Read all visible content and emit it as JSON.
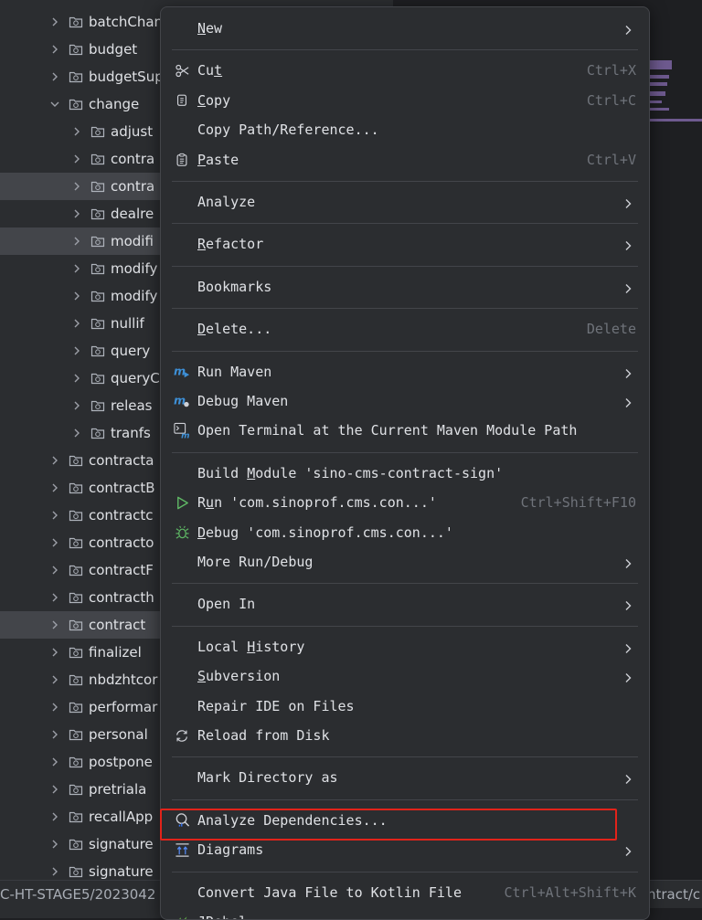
{
  "tree": {
    "items": [
      {
        "label": "batchChan",
        "level": 0,
        "expanded": false,
        "selected": false
      },
      {
        "label": "budget",
        "level": 0,
        "expanded": false,
        "selected": false
      },
      {
        "label": "budgetSup",
        "level": 0,
        "expanded": false,
        "selected": false
      },
      {
        "label": "change",
        "level": 0,
        "expanded": true,
        "selected": false
      },
      {
        "label": "adjust",
        "level": 1,
        "expanded": false,
        "selected": false
      },
      {
        "label": "contra",
        "level": 1,
        "expanded": false,
        "selected": false
      },
      {
        "label": "contra",
        "level": 1,
        "expanded": false,
        "selected": true
      },
      {
        "label": "dealre",
        "level": 1,
        "expanded": false,
        "selected": false
      },
      {
        "label": "modifi",
        "level": 1,
        "expanded": false,
        "selected": true
      },
      {
        "label": "modify",
        "level": 1,
        "expanded": false,
        "selected": false
      },
      {
        "label": "modify",
        "level": 1,
        "expanded": false,
        "selected": false
      },
      {
        "label": "nullif",
        "level": 1,
        "expanded": false,
        "selected": false
      },
      {
        "label": "query",
        "level": 1,
        "expanded": false,
        "selected": false
      },
      {
        "label": "queryC",
        "level": 1,
        "expanded": false,
        "selected": false
      },
      {
        "label": "releas",
        "level": 1,
        "expanded": false,
        "selected": false
      },
      {
        "label": "tranfs",
        "level": 1,
        "expanded": false,
        "selected": false
      },
      {
        "label": "contracta",
        "level": 0,
        "expanded": false,
        "selected": false
      },
      {
        "label": "contractB",
        "level": 0,
        "expanded": false,
        "selected": false
      },
      {
        "label": "contractc",
        "level": 0,
        "expanded": false,
        "selected": false
      },
      {
        "label": "contracto",
        "level": 0,
        "expanded": false,
        "selected": false
      },
      {
        "label": "contractF",
        "level": 0,
        "expanded": false,
        "selected": false
      },
      {
        "label": "contracth",
        "level": 0,
        "expanded": false,
        "selected": false
      },
      {
        "label": "contract",
        "level": 0,
        "expanded": false,
        "selected": true
      },
      {
        "label": "finalizel",
        "level": 0,
        "expanded": false,
        "selected": false
      },
      {
        "label": "nbdzhtcor",
        "level": 0,
        "expanded": false,
        "selected": false
      },
      {
        "label": "performar",
        "level": 0,
        "expanded": false,
        "selected": false
      },
      {
        "label": "personal",
        "level": 0,
        "expanded": false,
        "selected": false
      },
      {
        "label": "postpone",
        "level": 0,
        "expanded": false,
        "selected": false
      },
      {
        "label": "pretriala",
        "level": 0,
        "expanded": false,
        "selected": false
      },
      {
        "label": "recallApp",
        "level": 0,
        "expanded": false,
        "selected": false
      },
      {
        "label": "signature",
        "level": 0,
        "expanded": false,
        "selected": false
      },
      {
        "label": "signature",
        "level": 0,
        "expanded": false,
        "selected": false
      }
    ]
  },
  "statusbar": {
    "left_path": "C-HT-STAGE5/2023042",
    "right_path": "ntract/c"
  },
  "menu": {
    "items": [
      {
        "type": "item",
        "label": "New",
        "mn": 0,
        "icon": "",
        "shortcut": "",
        "submenu": true
      },
      {
        "type": "sep"
      },
      {
        "type": "item",
        "label": "Cut",
        "mn": 2,
        "icon": "scissors-icon",
        "shortcut": "Ctrl+X",
        "submenu": false
      },
      {
        "type": "item",
        "label": "Copy",
        "mn": 0,
        "icon": "copy-icon",
        "shortcut": "Ctrl+C",
        "submenu": false
      },
      {
        "type": "item",
        "label": "Copy Path/Reference...",
        "mn": -1,
        "icon": "",
        "shortcut": "",
        "submenu": false
      },
      {
        "type": "item",
        "label": "Paste",
        "mn": 0,
        "icon": "clipboard-icon",
        "shortcut": "Ctrl+V",
        "submenu": false
      },
      {
        "type": "sep"
      },
      {
        "type": "item",
        "label": "Analyze",
        "mn": -1,
        "icon": "",
        "shortcut": "",
        "submenu": true
      },
      {
        "type": "sep"
      },
      {
        "type": "item",
        "label": "Refactor",
        "mn": 0,
        "icon": "",
        "shortcut": "",
        "submenu": true
      },
      {
        "type": "sep"
      },
      {
        "type": "item",
        "label": "Bookmarks",
        "mn": -1,
        "icon": "",
        "shortcut": "",
        "submenu": true
      },
      {
        "type": "sep"
      },
      {
        "type": "item",
        "label": "Delete...",
        "mn": 0,
        "icon": "",
        "shortcut": "Delete",
        "submenu": false
      },
      {
        "type": "sep"
      },
      {
        "type": "item",
        "label": "Run Maven",
        "mn": -1,
        "icon": "maven-run-icon",
        "shortcut": "",
        "submenu": true
      },
      {
        "type": "item",
        "label": "Debug Maven",
        "mn": -1,
        "icon": "maven-debug-icon",
        "shortcut": "",
        "submenu": true
      },
      {
        "type": "item",
        "label": "Open Terminal at the Current Maven Module Path",
        "mn": -1,
        "icon": "maven-terminal-icon",
        "shortcut": "",
        "submenu": false
      },
      {
        "type": "sep"
      },
      {
        "type": "item",
        "label": "Build Module 'sino-cms-contract-sign'",
        "mn": 6,
        "icon": "",
        "shortcut": "",
        "submenu": false
      },
      {
        "type": "item",
        "label": "Run 'com.sinoprof.cms.con...'",
        "mn": 1,
        "icon": "run-icon",
        "shortcut": "Ctrl+Shift+F10",
        "submenu": false
      },
      {
        "type": "item",
        "label": "Debug 'com.sinoprof.cms.con...'",
        "mn": 0,
        "icon": "debug-icon",
        "shortcut": "",
        "submenu": false
      },
      {
        "type": "item",
        "label": "More Run/Debug",
        "mn": -1,
        "icon": "",
        "shortcut": "",
        "submenu": true
      },
      {
        "type": "sep"
      },
      {
        "type": "item",
        "label": "Open In",
        "mn": -1,
        "icon": "",
        "shortcut": "",
        "submenu": true
      },
      {
        "type": "sep"
      },
      {
        "type": "item",
        "label": "Local History",
        "mn": 6,
        "icon": "",
        "shortcut": "",
        "submenu": true
      },
      {
        "type": "item",
        "label": "Subversion",
        "mn": 0,
        "icon": "",
        "shortcut": "",
        "submenu": true
      },
      {
        "type": "item",
        "label": "Repair IDE on Files",
        "mn": -1,
        "icon": "",
        "shortcut": "",
        "submenu": false
      },
      {
        "type": "item",
        "label": "Reload from Disk",
        "mn": -1,
        "icon": "reload-icon",
        "shortcut": "",
        "submenu": false
      },
      {
        "type": "sep"
      },
      {
        "type": "item",
        "label": "Mark Directory as",
        "mn": -1,
        "icon": "",
        "shortcut": "",
        "submenu": true
      },
      {
        "type": "sep"
      },
      {
        "type": "item",
        "label": "Analyze Dependencies...",
        "mn": -1,
        "icon": "dependencies-icon",
        "shortcut": "",
        "submenu": false
      },
      {
        "type": "item",
        "label": "Diagrams",
        "mn": -1,
        "icon": "diagram-icon",
        "shortcut": "",
        "submenu": true,
        "highlighted": true
      },
      {
        "type": "sep"
      },
      {
        "type": "item",
        "label": "Convert Java File to Kotlin File",
        "mn": -1,
        "icon": "",
        "shortcut": "Ctrl+Alt+Shift+K",
        "submenu": false
      },
      {
        "type": "item",
        "label": "JRebel",
        "mn": -1,
        "icon": "jrebel-icon",
        "shortcut": "",
        "submenu": true
      },
      {
        "type": "sep"
      }
    ]
  },
  "colors": {
    "highlight_border": "#e2231a",
    "accent_blue": "#3574f0",
    "run_green": "#5fb865"
  }
}
